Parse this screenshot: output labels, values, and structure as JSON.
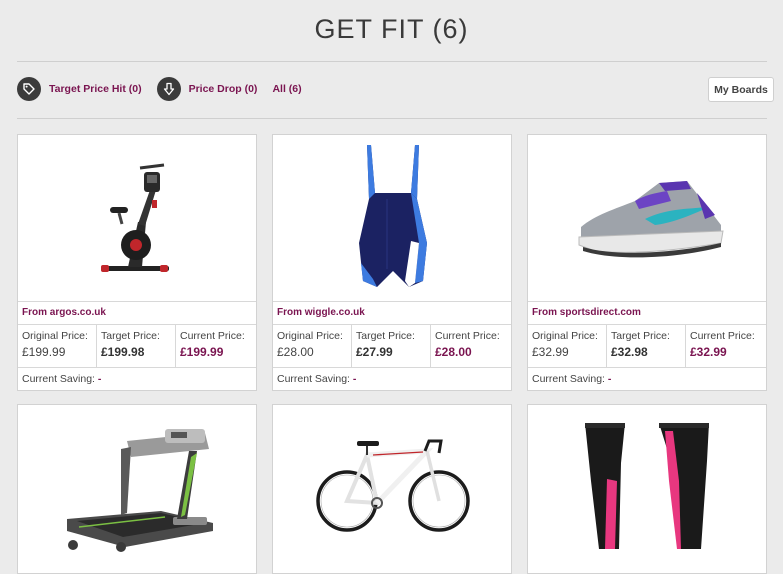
{
  "page": {
    "title": "GET FIT (6)"
  },
  "filters": [
    {
      "label": "Target Price Hit (0)",
      "icon": "tag-icon"
    },
    {
      "label": "Price Drop (0)",
      "icon": "arrow-down-icon"
    },
    {
      "label": "All (6)"
    }
  ],
  "my_boards_label": "My Boards",
  "labels": {
    "original": "Original Price:",
    "target": "Target Price:",
    "current": "Current Price:",
    "saving": "Current Saving:"
  },
  "products": [
    {
      "image": "exercise-bike",
      "from": "From argos.co.uk",
      "original": "£199.99",
      "target": "£199.98",
      "current": "£199.99",
      "saving": "-"
    },
    {
      "image": "swimsuit",
      "from": "From wiggle.co.uk",
      "original": "£28.00",
      "target": "£27.99",
      "current": "£28.00",
      "saving": "-"
    },
    {
      "image": "running-shoe",
      "from": "From sportsdirect.com",
      "original": "£32.99",
      "target": "£32.98",
      "current": "£32.99",
      "saving": "-"
    },
    {
      "image": "treadmill"
    },
    {
      "image": "road-bike"
    },
    {
      "image": "leggings"
    }
  ]
}
